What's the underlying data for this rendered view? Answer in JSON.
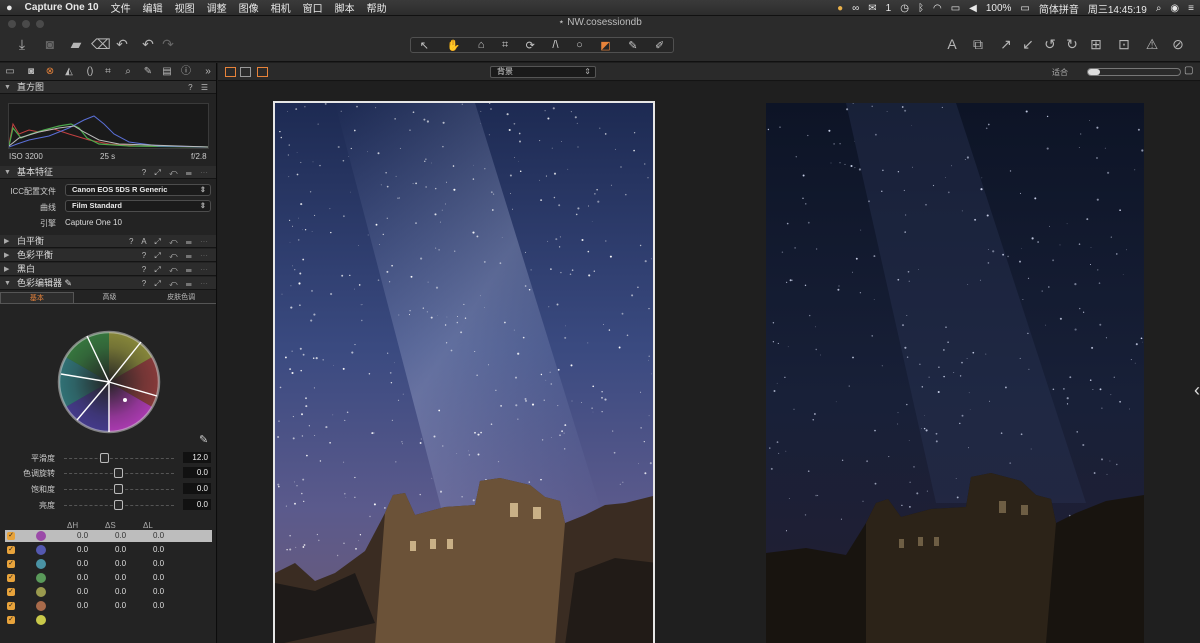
{
  "menubar": {
    "apple": "",
    "app_name": "Capture One 10",
    "items": [
      "文件",
      "编辑",
      "视图",
      "调整",
      "图像",
      "相机",
      "窗口",
      "脚本",
      "帮助"
    ],
    "status": {
      "wechat_count": "1",
      "battery": "100%",
      "input_method": "简体拼音",
      "clock": "周三14:45:19"
    }
  },
  "window": {
    "title": "NW.cosessiondb"
  },
  "viewer_bar": {
    "background_select": "背景",
    "fit_label": "适合"
  },
  "left_panel": {
    "histogram": {
      "title": "直方图",
      "iso": "ISO 3200",
      "shutter": "25 s",
      "aperture": "f/2.8"
    },
    "basic": {
      "title": "基本特征",
      "icc_label": "ICC配置文件",
      "icc_value": "Canon EOS 5DS R Generic",
      "curve_label": "曲线",
      "curve_value": "Film Standard",
      "engine_label": "引擎",
      "engine_value": "Capture One 10"
    },
    "collapsed_sections": [
      {
        "label": "白平衡"
      },
      {
        "label": "色彩平衡"
      },
      {
        "label": "黑白"
      }
    ],
    "color_editor": {
      "title": "色彩编辑器",
      "tabs": [
        "基本",
        "高级",
        "皮肤色调"
      ],
      "sliders": [
        {
          "label": "平滑度",
          "value": "12.0"
        },
        {
          "label": "色调旋转",
          "value": "0.0"
        },
        {
          "label": "饱和度",
          "value": "0.0"
        },
        {
          "label": "亮度",
          "value": "0.0"
        }
      ],
      "table_headers": [
        "ΔH",
        "ΔS",
        "ΔL"
      ],
      "rows": [
        {
          "h": "0.0",
          "s": "0.0",
          "l": "0.0",
          "color": "#9b4aa8"
        },
        {
          "h": "0.0",
          "s": "0.0",
          "l": "0.0",
          "color": "#5458b0"
        },
        {
          "h": "0.0",
          "s": "0.0",
          "l": "0.0",
          "color": "#4a93a5"
        },
        {
          "h": "0.0",
          "s": "0.0",
          "l": "0.0",
          "color": "#5a9a5a"
        },
        {
          "h": "0.0",
          "s": "0.0",
          "l": "0.0",
          "color": "#9a9a4e"
        },
        {
          "h": "0.0",
          "s": "0.0",
          "l": "0.0",
          "color": "#a86a4a"
        }
      ]
    }
  },
  "colors": {
    "accent": "#e8833a",
    "panel_bg": "#232323",
    "viewer_bg": "#1f1f1f"
  }
}
